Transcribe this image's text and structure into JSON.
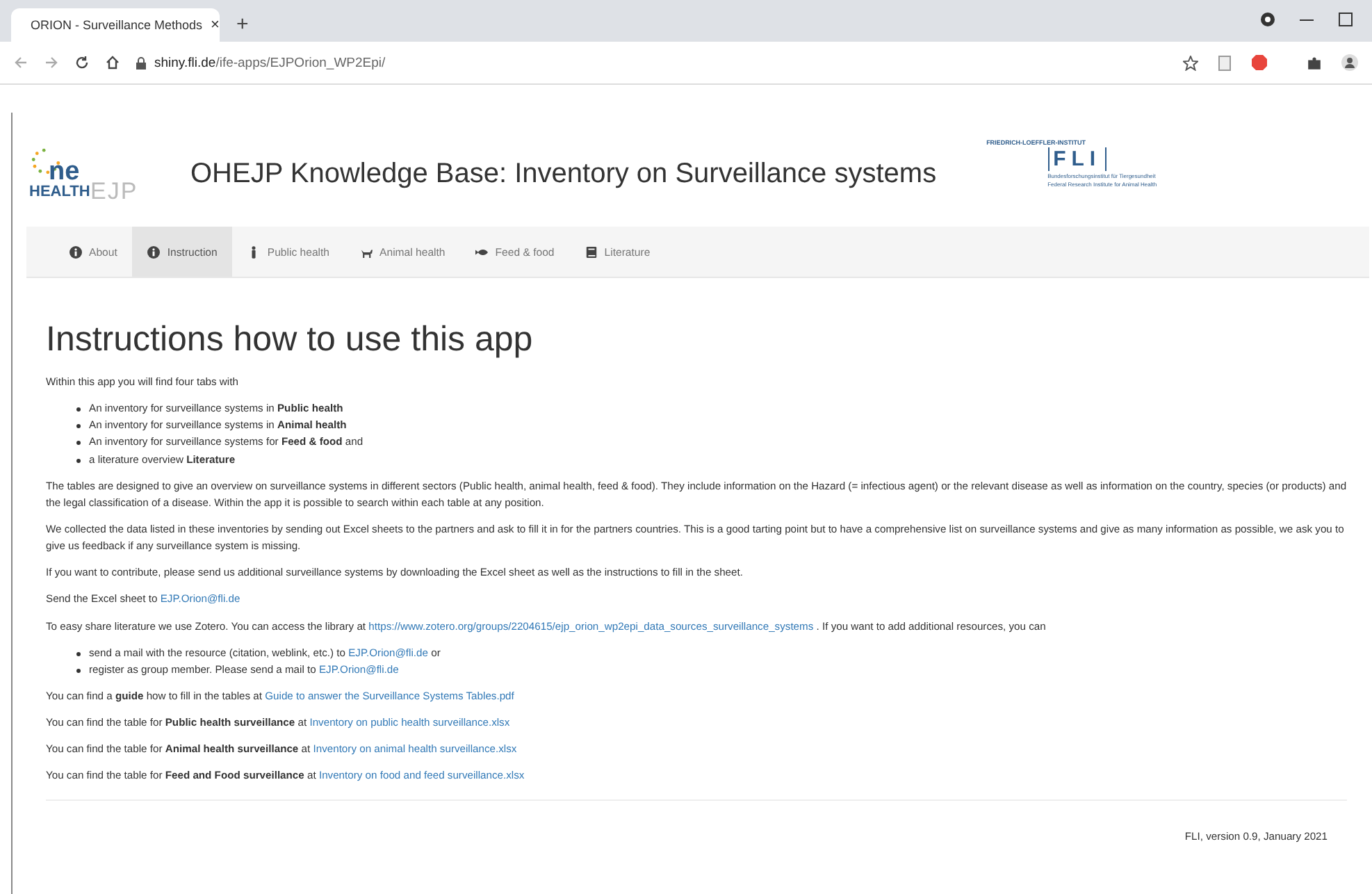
{
  "browser": {
    "tab": {
      "title": "ORION - Surveillance Methods",
      "close": "×"
    },
    "new_tab": "+",
    "url": {
      "host": "shiny.fli.de",
      "path": "/ife-apps/EJPOrion_WP2Epi/"
    }
  },
  "header": {
    "logo": {
      "one": "ne",
      "health": "HEALTH",
      "ejp": "EJP"
    },
    "title": "OHEJP Knowledge Base: Inventory on Surveillance systems",
    "partner_logo": {
      "top": "FRIEDRICH-LOEFFLER-INSTITUT",
      "abbr": "FLI",
      "line1": "Bundesforschungsinstitut für Tiergesundheit",
      "line2": "Federal Research Institute for Animal Health"
    }
  },
  "nav": [
    {
      "label": "About",
      "selected": false
    },
    {
      "label": "Instruction",
      "selected": true
    },
    {
      "label": "Public health",
      "selected": false
    },
    {
      "label": "Animal health",
      "selected": false
    },
    {
      "label": "Feed & food",
      "selected": false
    },
    {
      "label": "Literature",
      "selected": false
    }
  ],
  "content": {
    "heading": "Instructions how to use this app",
    "blocks": [
      {
        "kind": "para",
        "parts": [
          {
            "kind": "text",
            "text": "Within this app you will find four tabs with"
          }
        ]
      },
      {
        "kind": "list",
        "items": [
          {
            "parts": [
              {
                "kind": "text",
                "text": "An inventory for surveillance systems in **Public health**"
              }
            ]
          },
          {
            "parts": [
              {
                "kind": "text",
                "text": "An inventory for surveillance systems in **Animal health**"
              }
            ]
          },
          {
            "parts": [
              {
                "kind": "text",
                "text": "An inventory for surveillance systems for **Feed & food** and"
              }
            ]
          },
          {
            "parts": [
              {
                "kind": "text",
                "text": "a literature overview **Literature**"
              }
            ]
          }
        ]
      },
      {
        "kind": "para",
        "parts": [
          {
            "kind": "text",
            "text": "The tables are designed to give an overview on surveillance systems in different sectors (Public health, animal health, feed & food). They include information on the Hazard (= infectious agent) or the relevant disease as well as information on the country, species (or products) and the legal classification of a disease. Within the app it is possible to search within each table at any position."
          }
        ]
      },
      {
        "kind": "para",
        "parts": [
          {
            "kind": "text",
            "text": "We collected the data listed in these inventories by sending out Excel sheets to the partners and ask to fill it in for the partners countries. This is a good tarting point but to have a comprehensive list on surveillance systems and give as many information as possible, we ask you to give us feedback if any surveillance system is missing."
          }
        ]
      },
      {
        "kind": "para",
        "parts": [
          {
            "kind": "text",
            "text": "If you want to contribute, please send us additional surveillance systems by downloading the Excel sheet as well as the instructions to fill in the sheet."
          }
        ]
      },
      {
        "kind": "para",
        "parts": [
          {
            "kind": "text",
            "text": "Send the Excel sheet to"
          },
          {
            "kind": "link",
            "text": "EJP.Orion@fli.de"
          }
        ]
      },
      {
        "kind": "para",
        "parts": [
          {
            "kind": "text",
            "text": "To easy share literature we use Zotero. You can access the library at"
          },
          {
            "kind": "link",
            "text": "https://www.zotero.org/groups/2204615/ejp_orion_wp2epi_data_sources_surveillance_systems"
          },
          {
            "kind": "text",
            "text": ". If you want to add additional resources, you can"
          }
        ]
      },
      {
        "kind": "list",
        "items": [
          {
            "parts": [
              {
                "kind": "text",
                "text": "send a mail with the resource (citation, weblink, etc.) to"
              },
              {
                "kind": "link",
                "text": "EJP.Orion@fli.de"
              },
              {
                "kind": "text",
                "text": "or"
              }
            ]
          },
          {
            "parts": [
              {
                "kind": "text",
                "text": "register as group member. Please send a mail to"
              },
              {
                "kind": "link",
                "text": "EJP.Orion@fli.de"
              }
            ]
          }
        ]
      },
      {
        "kind": "para",
        "parts": [
          {
            "kind": "text",
            "text": "You can find a **guide** how to fill in the tables at"
          },
          {
            "kind": "link",
            "text": "Guide to answer the Surveillance Systems Tables.pdf"
          }
        ]
      },
      {
        "kind": "para",
        "parts": [
          {
            "kind": "text",
            "text": "You can find the table for **Public health surveillance** at"
          },
          {
            "kind": "link",
            "text": "Inventory on public health surveillance.xlsx"
          }
        ]
      },
      {
        "kind": "para",
        "parts": [
          {
            "kind": "text",
            "text": "You can find the table for **Animal health surveillance** at"
          },
          {
            "kind": "link",
            "text": "Inventory on animal health surveillance.xlsx"
          }
        ]
      },
      {
        "kind": "para",
        "parts": [
          {
            "kind": "text",
            "text": "You can find the table for **Feed and Food surveillance** at"
          },
          {
            "kind": "link",
            "text": "Inventory on food and feed surveillance.xlsx"
          }
        ]
      }
    ]
  },
  "footer": "FLI, version 0.9, January 2021"
}
